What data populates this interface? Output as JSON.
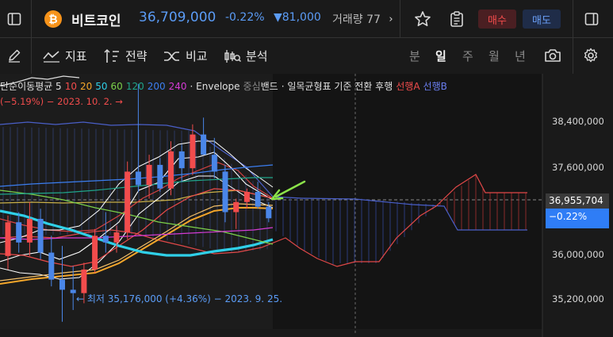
{
  "header": {
    "coin_symbol": "₿",
    "title": "비트코인",
    "price": "36,709,000",
    "change_pct": "-0.22%",
    "change_amount": "▼81,000",
    "volume_label": "거래량 77",
    "buy_label": "매수",
    "sell_label": "매도",
    "icons": [
      "sidebar-toggle-icon",
      "bitcoin-icon",
      "chevron-right-icon",
      "star-icon",
      "clipboard-icon",
      "panel-icon"
    ]
  },
  "toolbar": {
    "indicator_label": "지표",
    "strategy_label": "전략",
    "compare_label": "비교",
    "analysis_label": "분석",
    "periods": [
      "분",
      "일",
      "주",
      "월",
      "년"
    ],
    "active_period": "일",
    "icons": [
      "pencil-icon",
      "indicator-icon",
      "strategy-icon",
      "compare-icon",
      "analysis-icon",
      "camera-icon",
      "gear-icon"
    ]
  },
  "legend": {
    "ma_label": "단순이동평균 5",
    "ma_values": [
      {
        "text": "10",
        "color": "#f24c4c"
      },
      {
        "text": "20",
        "color": "#f4a62a"
      },
      {
        "text": "50",
        "color": "#2fd0e8"
      },
      {
        "text": "60",
        "color": "#7bd14a"
      },
      {
        "text": "120",
        "color": "#1fa58a"
      },
      {
        "text": "200",
        "color": "#3b7ef0"
      },
      {
        "text": "240",
        "color": "#d43bd4"
      }
    ],
    "envelope": "· Envelope",
    "center_band": "중심",
    "band": "밴드",
    "ichimoku": "· 일목균형표 기준 전환 후행",
    "span_a": "선행A",
    "span_b": "선행B",
    "high_note": "(−5.19%) − 2023. 10. 2. →",
    "low_note": "← 최저 35,176,000 (+4.36%) − 2023. 9. 25."
  },
  "y_axis": {
    "labels": [
      "38,400,000",
      "37,600,000",
      "36,000,000",
      "35,200,000"
    ],
    "current_price": "36,955,704",
    "current_pct": "−0.22%"
  },
  "colors": {
    "up": "#f24c4c",
    "down": "#4a86e8",
    "accent_blue": "#5b9cf6",
    "arrow_green": "#8be34a"
  },
  "chart_data": {
    "type": "candlestick",
    "ylim": [
      34950000,
      38850000
    ],
    "candles": [
      {
        "o": 36150000,
        "h": 36750000,
        "l": 35950000,
        "c": 36650000
      },
      {
        "o": 36650000,
        "h": 36800000,
        "l": 36200000,
        "c": 36350000
      },
      {
        "o": 36350000,
        "h": 36950000,
        "l": 36150000,
        "c": 36700000
      },
      {
        "o": 36700000,
        "h": 36850000,
        "l": 36100000,
        "c": 36200000
      },
      {
        "o": 36200000,
        "h": 36450000,
        "l": 35700000,
        "c": 35800000
      },
      {
        "o": 35800000,
        "h": 36300000,
        "l": 35176000,
        "c": 35650000
      },
      {
        "o": 35650000,
        "h": 36000000,
        "l": 35350000,
        "c": 35600000
      },
      {
        "o": 35600000,
        "h": 36050000,
        "l": 35450000,
        "c": 35950000
      },
      {
        "o": 35950000,
        "h": 36550000,
        "l": 35900000,
        "c": 36450000
      },
      {
        "o": 36450000,
        "h": 36800000,
        "l": 36200000,
        "c": 36350000
      },
      {
        "o": 36350000,
        "h": 36600000,
        "l": 36200000,
        "c": 36500000
      },
      {
        "o": 36500000,
        "h": 37550000,
        "l": 36400000,
        "c": 37400000
      },
      {
        "o": 37400000,
        "h": 38700000,
        "l": 37100000,
        "c": 37200000
      },
      {
        "o": 37200000,
        "h": 37650000,
        "l": 37000000,
        "c": 37500000
      },
      {
        "o": 37500000,
        "h": 37600000,
        "l": 37100000,
        "c": 37150000
      },
      {
        "o": 37150000,
        "h": 37850000,
        "l": 37050000,
        "c": 37700000
      },
      {
        "o": 37700000,
        "h": 37800000,
        "l": 37250000,
        "c": 37450000
      },
      {
        "o": 37450000,
        "h": 38100000,
        "l": 37350000,
        "c": 37950000
      },
      {
        "o": 37950000,
        "h": 38200000,
        "l": 37650000,
        "c": 37650000
      },
      {
        "o": 37650000,
        "h": 37900000,
        "l": 37300000,
        "c": 37400000
      },
      {
        "o": 37400000,
        "h": 37500000,
        "l": 36650000,
        "c": 36800000
      },
      {
        "o": 36800000,
        "h": 37000000,
        "l": 36550000,
        "c": 36950000
      },
      {
        "o": 36950000,
        "h": 37150000,
        "l": 36850000,
        "c": 37100000
      },
      {
        "o": 37100000,
        "h": 37250000,
        "l": 36850000,
        "c": 36880000
      },
      {
        "o": 36880000,
        "h": 36950000,
        "l": 36650000,
        "c": 36709000
      }
    ]
  }
}
